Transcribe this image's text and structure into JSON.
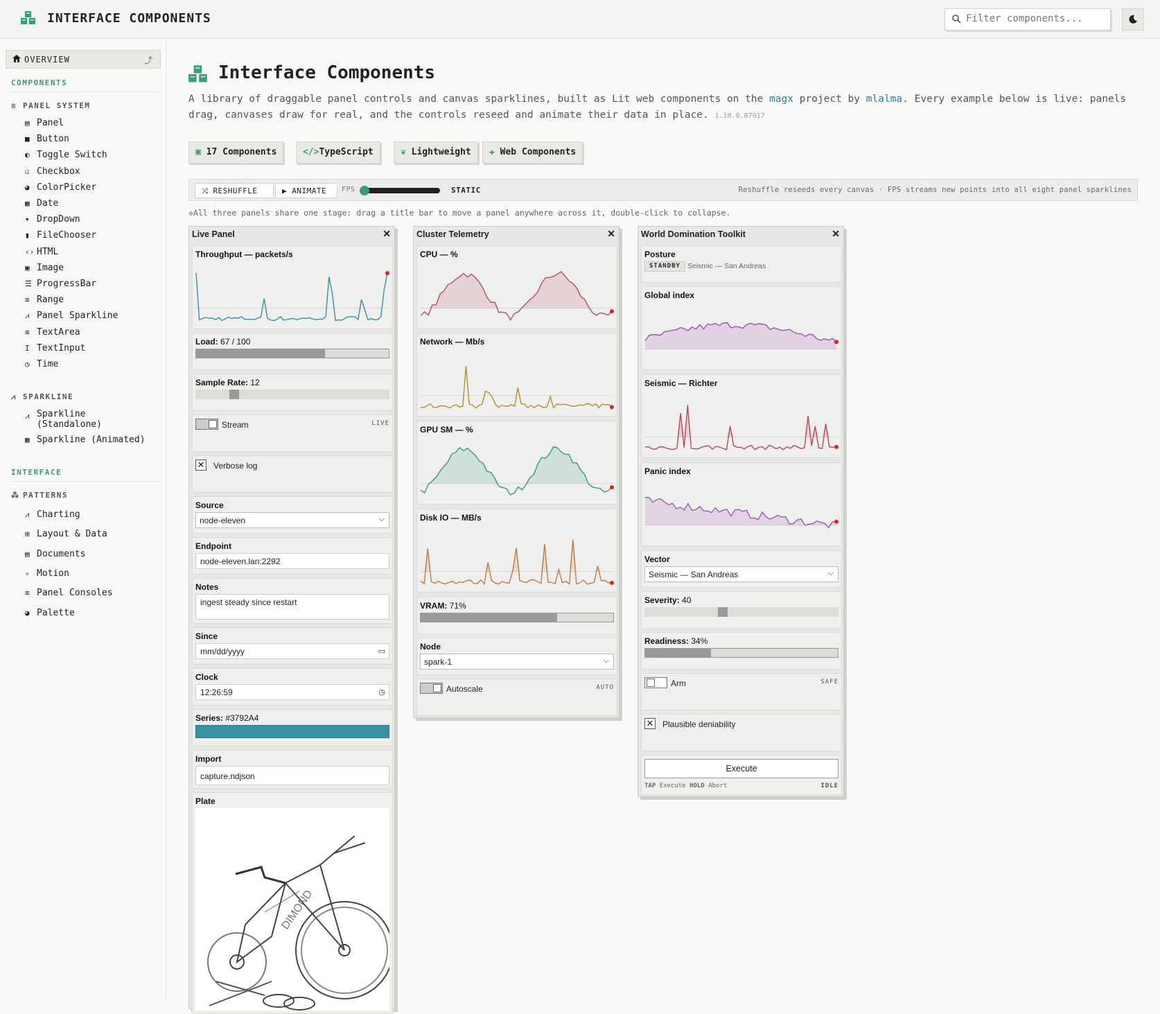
{
  "header": {
    "title": "INTERFACE COMPONENTS",
    "filter_placeholder": "Filter components..."
  },
  "sidebar": {
    "overview": "OVERVIEW",
    "section_components": "COMPONENTS",
    "group_panel": "PANEL SYSTEM",
    "panel_items": [
      "Panel",
      "Button",
      "Toggle Switch",
      "Checkbox",
      "ColorPicker",
      "Date",
      "DropDown",
      "FileChooser",
      "HTML",
      "Image",
      "ProgressBar",
      "Range",
      "Panel Sparkline",
      "TextArea",
      "TextInput",
      "Time"
    ],
    "group_sparkline": "SPARKLINE",
    "spark_items": [
      "Sparkline\n(Standalone)",
      "Sparkline (Animated)"
    ],
    "section_interface": "INTERFACE",
    "group_patterns": "PATTERNS",
    "pattern_items": [
      "Charting",
      "Layout & Data",
      "Documents",
      "Motion",
      "Panel Consoles",
      "Palette"
    ]
  },
  "main": {
    "title": "Interface Components",
    "desc_1": "A library of draggable panel controls and canvas sparklines, built as Lit web components on the ",
    "desc_link_1": "magx",
    "desc_2": " project by ",
    "desc_link_2": "mlalma",
    "desc_3": ". Every example below is live: panels drag, canvases draw for real, and the controls reseed and animate their data in place.",
    "version": "1.10.0.07017",
    "badges": [
      "17 Components",
      "TypeScript",
      "Lightweight",
      "Web Components"
    ],
    "toolbar": {
      "reshuffle": "RESHUFFLE",
      "animate": "ANIMATE",
      "fps": "FPS",
      "mode": "STATIC",
      "note": "Reshuffle reseeds every canvas · FPS streams new points into all eight panel sparklines"
    },
    "hint": "All three panels share one stage: drag a title bar to move a panel anywhere across it, double-click to collapse."
  },
  "live": {
    "title": "Live Panel",
    "throughput": "Throughput — packets/s",
    "load_label": "Load:",
    "load_value": "67 / 100",
    "load": 0.67,
    "rate_label": "Sample Rate:",
    "rate_value": "12",
    "stream": "Stream",
    "stream_tag": "LIVE",
    "verbose": "Verbose log",
    "source_label": "Source",
    "source_value": "node-eleven",
    "endpoint_label": "Endpoint",
    "endpoint_value": "node-eleven.lan:2292",
    "notes_label": "Notes",
    "notes_value": "ingest steady since restart",
    "since_label": "Since",
    "since_value": "mm/dd/yyyy",
    "clock_label": "Clock",
    "clock_value": "12:26:59",
    "series_label": "Series:",
    "series_value": "#3792A4",
    "series_color": "#3792a4",
    "import_label": "Import",
    "import_value": "capture.ndjson",
    "plate_label": "Plate"
  },
  "cluster": {
    "title": "Cluster Telemetry",
    "cpu": "CPU — %",
    "network": "Network — Mb/s",
    "gpu": "GPU SM — %",
    "disk": "Disk IO — MB/s",
    "vram_label": "VRAM:",
    "vram_value": "71%",
    "vram": 0.71,
    "node_label": "Node",
    "node_value": "spark-1",
    "autoscale": "Autoscale",
    "autoscale_tag": "AUTO"
  },
  "world": {
    "title": "World Domination Toolkit",
    "posture_label": "Posture",
    "posture_badge": "STANDBY",
    "posture_text": "Seismic — San Andreas",
    "global": "Global index",
    "seismic": "Seismic — Richter",
    "panic": "Panic index",
    "vector_label": "Vector",
    "vector_value": "Seismic — San Andreas",
    "severity_label": "Severity:",
    "severity_value": "40",
    "readiness_label": "Readiness:",
    "readiness_value": "34%",
    "readiness": 0.34,
    "arm": "Arm",
    "arm_tag": "SAFE",
    "deniability": "Plausible deniability",
    "execute": "Execute",
    "foot_tap": "TAP",
    "foot_tap_action": "Execute",
    "foot_hold": "HOLD",
    "foot_hold_action": "Abort",
    "foot_state": "IDLE"
  },
  "colors": {
    "accent": "#3b9a7a",
    "throughput": "#3a8fa8",
    "cpu": "#b0506a",
    "network": "#b09030",
    "gpu": "#3a9a78",
    "disk": "#c07848",
    "global": "#a050b0",
    "seismic": "#b84a58",
    "panic": "#9a5ab8",
    "marker": "#e02020"
  }
}
